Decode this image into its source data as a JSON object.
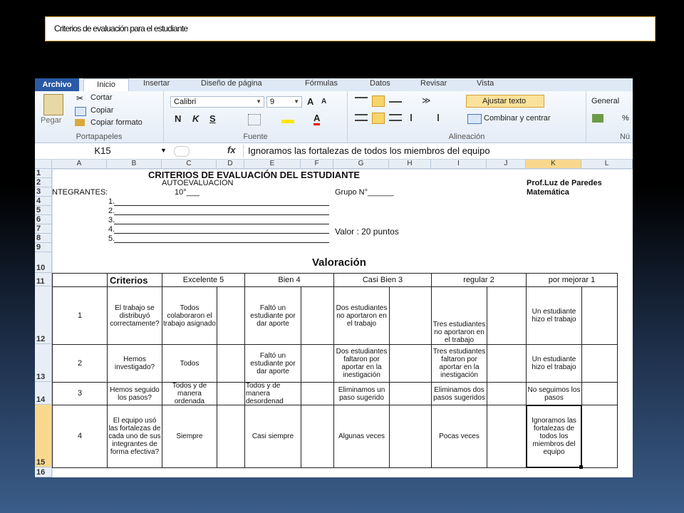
{
  "slide_title": "Criterios de evaluación para el estudiante",
  "ribbon": {
    "tabs": [
      "Archivo",
      "Inicio",
      "Insertar",
      "Diseño de página",
      "Fórmulas",
      "Datos",
      "Revisar",
      "Vista"
    ],
    "clipboard": {
      "paste": "Pegar",
      "cut": "Cortar",
      "copy": "Copiar",
      "format_painter": "Copiar formato",
      "label": "Portapapeles"
    },
    "font": {
      "name": "Calibri",
      "size": "9",
      "bold": "N",
      "italic": "K",
      "underline": "S",
      "label": "Fuente"
    },
    "alignment": {
      "wrap": "Ajustar texto",
      "merge": "Combinar y centrar",
      "label": "Alineación"
    },
    "number": {
      "format": "General",
      "label": "Nú"
    }
  },
  "formula_bar": {
    "name_box": "K15",
    "fx": "fx",
    "content": "Ignoramos las fortalezas de todos los miembros del equipo"
  },
  "columns": [
    "A",
    "B",
    "C",
    "D",
    "E",
    "F",
    "G",
    "H",
    "I",
    "J",
    "K",
    "L"
  ],
  "rows": [
    "1",
    "2",
    "3",
    "4",
    "5",
    "6",
    "7",
    "8",
    "9",
    "10",
    "11",
    "12",
    "13",
    "14",
    "15",
    "16"
  ],
  "sheet": {
    "title": "CRITERIOS DE EVALUACIÓN  DEL ESTUDIANTE",
    "subtitle": "AUTOEVALUACIÓN",
    "teacher": "Prof.Luz de Paredes",
    "subject": "Matemática",
    "members_label": "NTEGRANTES:",
    "grade": "10°___",
    "group": "Grupo N°______",
    "member_lines": [
      "1.",
      "2.",
      "3.",
      "4.",
      "5."
    ],
    "value": "Valor : 20 puntos",
    "valoracion": "Valoración",
    "headers": [
      "Criterios",
      "Excelente  5",
      "Bien 4",
      "Casi Bien 3",
      "regular 2",
      "por mejorar 1"
    ],
    "criteria": [
      {
        "num": "1",
        "criterion": "El trabajo se distribuyó correctamente?",
        "c5": "Todos colaboraron el trabajo asignado",
        "c4": "Faltó un estudiante por dar aporte",
        "c3": "Dos estudiantes no aportaron en el trabajo",
        "c2": "Tres estudiantes no aportaron en el trabajo",
        "c1": "Un estudiante hizo el trabajo"
      },
      {
        "num": "2",
        "criterion": "Hemos investigado?",
        "c5": "Todos",
        "c4": "Faltó un estudiante por dar aporte",
        "c3": "Dos estudiantes faltaron por aportar en la inestigación",
        "c2": "Tres estudiantes faltaron por aportar en la inestigación",
        "c1": "Un estudiante hizo el trabajo"
      },
      {
        "num": "3",
        "criterion": "Hemos seguido los pasos?",
        "c5": "Todos y de manera ordenada",
        "c4": "Todos y de manera desordenad",
        "c3": "Eliminamos un paso sugerido",
        "c2": "Eliminamos dos pasos sugeridos",
        "c1": "No seguimos los pasos"
      },
      {
        "num": "4",
        "criterion": "El equipo usó las fortalezas de cada uno de sus integrantes de forma efectiva?",
        "c5": "Siempre",
        "c4": "Casi siempre",
        "c3": "Algunas veces",
        "c2": "Pocas veces",
        "c1": "Ignoramos las fortalezas de todos los miembros del equipo"
      }
    ]
  }
}
